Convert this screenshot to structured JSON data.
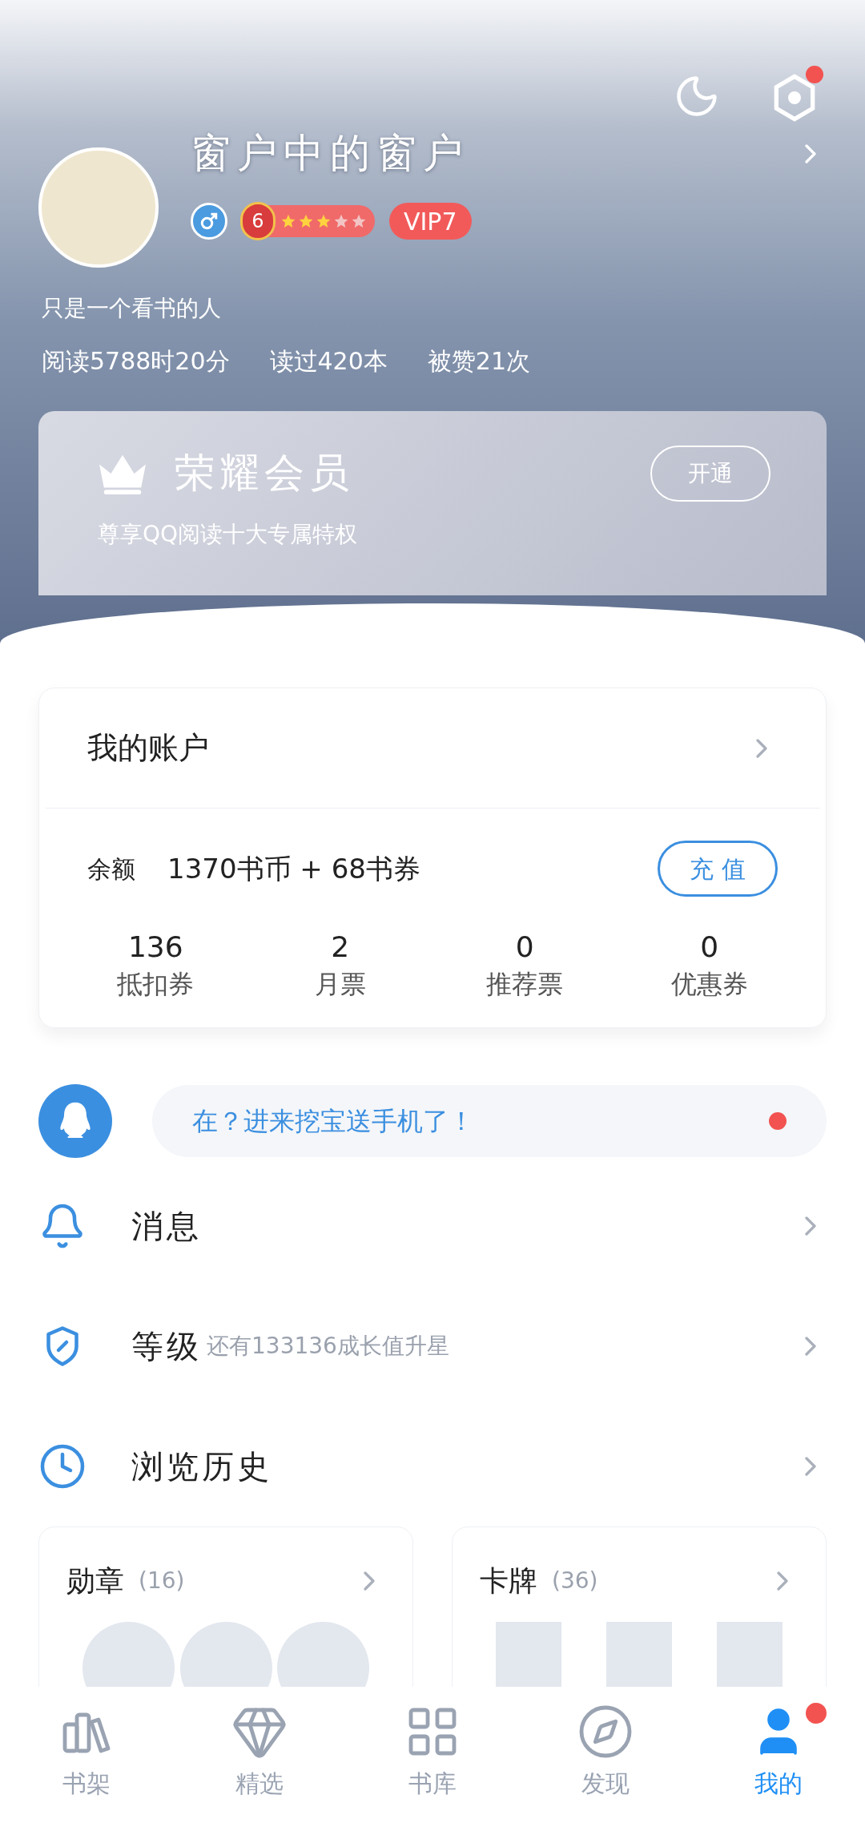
{
  "header": {
    "settings_dot": true
  },
  "profile": {
    "name": "窗户中的窗户",
    "level": "6",
    "stars": 3,
    "vip": "VIP7",
    "bio": "只是一个看书的人",
    "stats": [
      "阅读5788时20分",
      "读过420本",
      "被赞21次"
    ]
  },
  "member": {
    "title": "荣耀会员",
    "subtitle": "尊享QQ阅读十大专属特权",
    "button": "开通"
  },
  "account": {
    "title": "我的账户",
    "balance_label": "余额",
    "balance": "1370书币 + 68书券",
    "recharge": "充 值",
    "stats": [
      {
        "value": "136",
        "label": "抵扣券"
      },
      {
        "value": "2",
        "label": "月票"
      },
      {
        "value": "0",
        "label": "推荐票"
      },
      {
        "value": "0",
        "label": "优惠券"
      }
    ]
  },
  "promo": {
    "text": "在？进来挖宝送手机了！",
    "dot": true
  },
  "menu": [
    {
      "kind": "bell",
      "label": "消息"
    },
    {
      "kind": "shield",
      "label": "等级",
      "note": "还有133136成长值升星"
    },
    {
      "kind": "clock",
      "label": "浏览历史"
    }
  ],
  "cards": [
    {
      "kind": "medals",
      "title": "勋章",
      "count": "(16)"
    },
    {
      "kind": "cards",
      "title": "卡牌",
      "count": "(36)"
    }
  ],
  "tabs": [
    {
      "kind": "shelf",
      "label": "书架",
      "selected": false,
      "dot": false
    },
    {
      "kind": "gem",
      "label": "精选",
      "selected": false,
      "dot": false
    },
    {
      "kind": "grid",
      "label": "书库",
      "selected": false,
      "dot": false
    },
    {
      "kind": "compass",
      "label": "发现",
      "selected": false,
      "dot": false
    },
    {
      "kind": "user",
      "label": "我的",
      "selected": true,
      "dot": true
    }
  ]
}
